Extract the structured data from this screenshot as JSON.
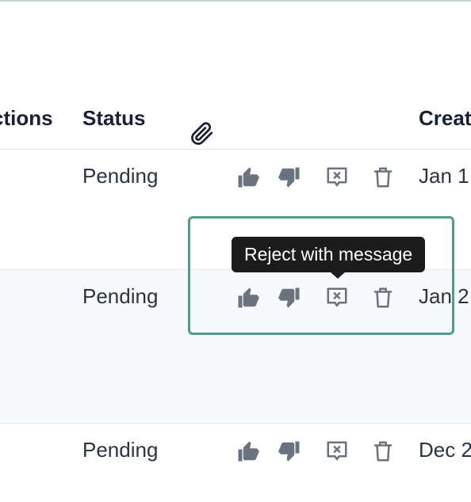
{
  "table": {
    "headers": {
      "actions": "ctions",
      "status": "Status",
      "attachment_icon": "paperclip-icon",
      "created": "Creat"
    },
    "rows": [
      {
        "status": "Pending",
        "created": "Jan 1"
      },
      {
        "status": "Pending",
        "created": "Jan 2"
      },
      {
        "status": "Pending",
        "created": "Dec 2"
      }
    ],
    "row_actions": [
      "thumbs-up-icon",
      "thumbs-down-icon",
      "message-reject-icon",
      "trash-icon"
    ]
  },
  "tooltip": {
    "text": "Reject with message"
  },
  "colors": {
    "header_text": "#17213a",
    "body_text": "#2b3441",
    "icon": "#6b7280",
    "focus_border": "#4f9d8c",
    "tooltip_bg": "#1c1c1c",
    "highlight_row_bg": "#f7f9fc"
  }
}
